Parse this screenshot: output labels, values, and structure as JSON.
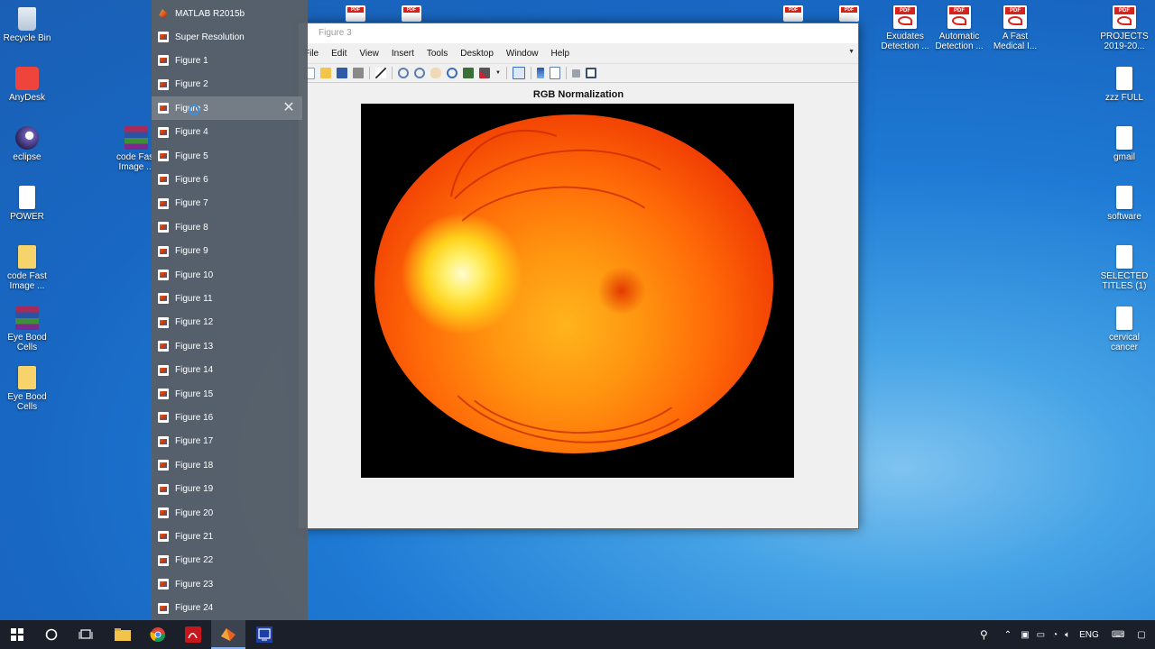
{
  "desktop_left": [
    {
      "label": "Recycle Bin",
      "type": "recycle"
    },
    {
      "label": "AnyDesk",
      "type": "anydesk"
    },
    {
      "label": "eclipse",
      "type": "eclipse"
    },
    {
      "label": "POWER",
      "type": "doc"
    },
    {
      "label": "code Fast Image ...",
      "type": "folder"
    },
    {
      "label": "Eye Bood Cells",
      "type": "winrar"
    },
    {
      "label": "Eye Bood Cells",
      "type": "folder"
    }
  ],
  "desktop_middle": [
    {
      "label": "code Fast Image ...",
      "type": "winrar"
    }
  ],
  "desktop_right_top": [
    {
      "label": "Exudates Detection ...",
      "type": "pdf"
    },
    {
      "label": "Automatic Detection ...",
      "type": "pdf"
    },
    {
      "label": "A Fast Medical I...",
      "type": "pdf"
    },
    {
      "label": "PROJECTS 2019-20...",
      "type": "pdf"
    }
  ],
  "desktop_right_col": [
    {
      "label": "zzz FULL",
      "type": "doc"
    },
    {
      "label": "gmail",
      "type": "doc"
    },
    {
      "label": "software",
      "type": "doc"
    },
    {
      "label": "SELECTED TITLES (1)",
      "type": "doc"
    },
    {
      "label": "cervical cancer",
      "type": "doc"
    }
  ],
  "jumplist": {
    "app_title": "MATLAB R2015b",
    "items": [
      "Super Resolution",
      "Figure 1",
      "Figure 2",
      "Figure 3",
      "Figure 4",
      "Figure 5",
      "Figure 6",
      "Figure 7",
      "Figure 8",
      "Figure 9",
      "Figure 10",
      "Figure 11",
      "Figure 12",
      "Figure 13",
      "Figure 14",
      "Figure 15",
      "Figure 16",
      "Figure 17",
      "Figure 18",
      "Figure 19",
      "Figure 20",
      "Figure 21",
      "Figure 22",
      "Figure 23",
      "Figure 24"
    ],
    "hovered": "Figure 3",
    "close_glyph": "✕"
  },
  "figure_window": {
    "title": "Figure 3",
    "menus": [
      "File",
      "Edit",
      "View",
      "Insert",
      "Tools",
      "Desktop",
      "Window",
      "Help"
    ],
    "axes_title": "RGB Normalization"
  },
  "taskbar": {
    "tray_language": "ENG"
  }
}
